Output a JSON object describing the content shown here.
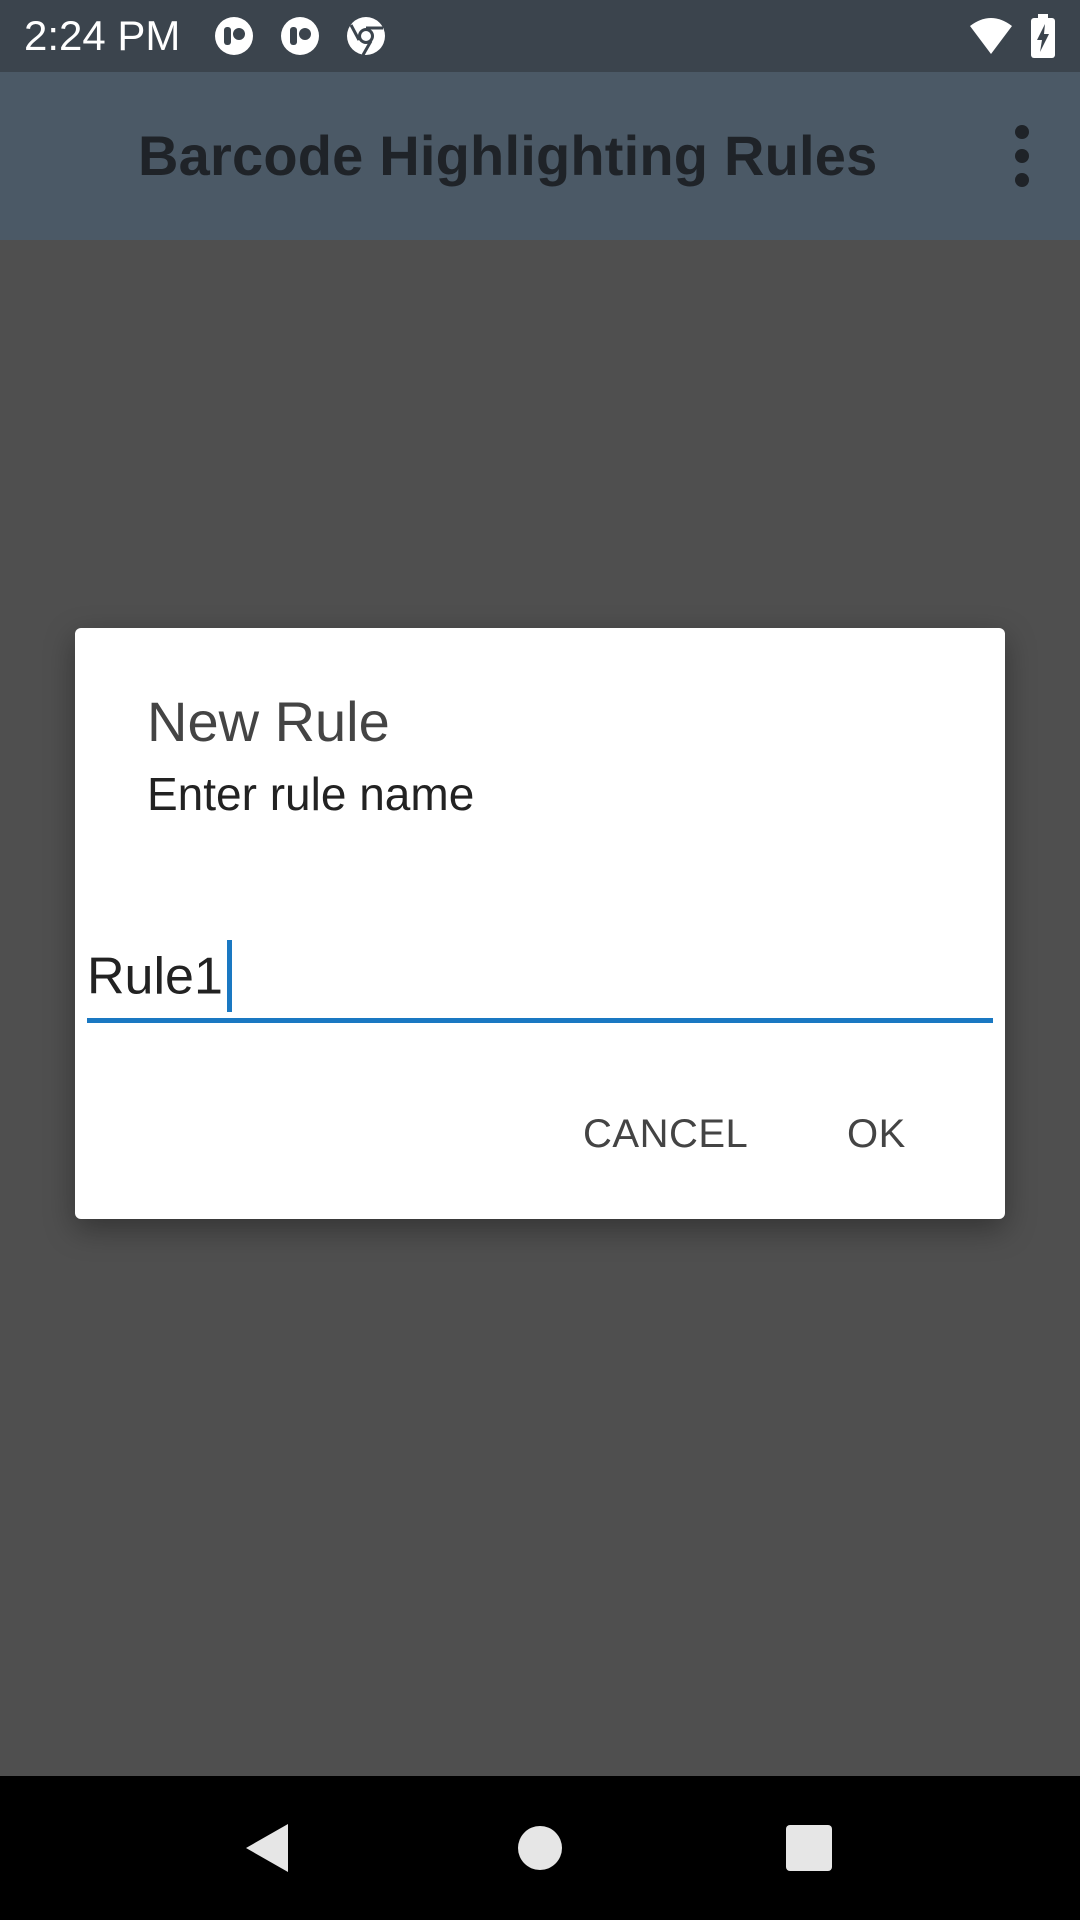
{
  "status_bar": {
    "time": "2:24 PM",
    "icons": [
      "app-notification-icon",
      "app-notification-icon",
      "chrome-icon",
      "wifi-icon",
      "battery-charging-icon"
    ],
    "wifi_badge": "4"
  },
  "app_bar": {
    "title": "Barcode Highlighting Rules",
    "menu_icon": "more-vert-icon"
  },
  "dialog": {
    "title": "New Rule",
    "message": "Enter rule name",
    "input_value": "Rule1",
    "cancel_label": "CANCEL",
    "ok_label": "OK"
  },
  "nav_bar": {
    "icons": [
      "back-icon",
      "home-icon",
      "recents-icon"
    ]
  },
  "colors": {
    "status_bar": "#3b444d",
    "app_bar": "#4b5966",
    "scrim": "#4f4f4f",
    "accent": "#1a78c2"
  }
}
